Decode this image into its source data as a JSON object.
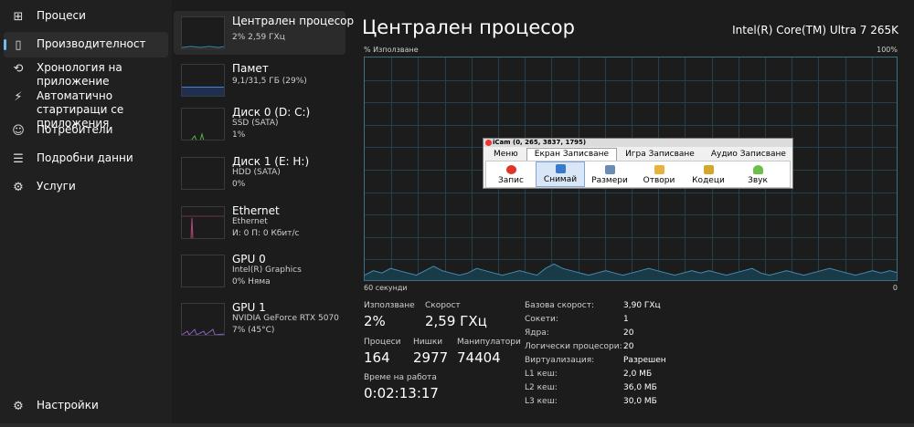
{
  "nav": {
    "items": [
      {
        "label": "Процеси",
        "icon": "processes-icon",
        "glyph": "⊞"
      },
      {
        "label": "Производителност",
        "icon": "performance-icon",
        "glyph": "▯",
        "active": true
      },
      {
        "label": "Хронология на приложение",
        "icon": "history-icon",
        "glyph": "⟲"
      },
      {
        "label": "Автоматично стартиращи се приложения",
        "icon": "startup-icon",
        "glyph": "⚡"
      },
      {
        "label": "Потребители",
        "icon": "users-icon",
        "glyph": "☺"
      },
      {
        "label": "Подробни данни",
        "icon": "details-icon",
        "glyph": "☰"
      },
      {
        "label": "Услуги",
        "icon": "services-icon",
        "glyph": "⚙"
      }
    ],
    "settings": {
      "label": "Настройки",
      "icon": "settings-icon",
      "glyph": "⚙"
    }
  },
  "devices": [
    {
      "title": "Централен процесор",
      "sub1": "2% 2,59 ГХц",
      "sub2": "",
      "color": "#3d8fb5"
    },
    {
      "title": "Памет",
      "sub1": "9,1/31,5 ГБ (29%)",
      "sub2": "",
      "color": "#4b7fd1"
    },
    {
      "title": "Диск 0 (D: C:)",
      "sub1": "SSD (SATA)",
      "sub2": "1%",
      "color": "#5cae4c"
    },
    {
      "title": "Диск 1 (E: H:)",
      "sub1": "HDD (SATA)",
      "sub2": "0%",
      "color": "#5cae4c"
    },
    {
      "title": "Ethernet",
      "sub1": "Ethernet",
      "sub2": "И: 0 П: 0 Кбит/с",
      "color": "#b5487a"
    },
    {
      "title": "GPU 0",
      "sub1": "Intel(R) Graphics",
      "sub2": "0% Няма",
      "color": "#8e5cc4"
    },
    {
      "title": "GPU 1",
      "sub1": "NVIDIA GeForce RTX 5070",
      "sub2": "7% (45°C)",
      "color": "#8e5cc4"
    }
  ],
  "main": {
    "title": "Централен процесор",
    "cpu_model": "Intel(R) Core(TM) Ultra 7 265K",
    "graph": {
      "y_label": "% Използване",
      "y_max_label": "100%",
      "x_left_label": "60 секунди",
      "x_right_label": "0",
      "line_color": "#3d8fb5",
      "fill_color": "#1b3a48",
      "values": [
        3,
        5,
        4,
        6,
        5,
        4,
        3,
        5,
        7,
        5,
        4,
        3,
        4,
        6,
        5,
        4,
        3,
        4,
        5,
        4,
        3,
        6,
        8,
        6,
        5,
        4,
        3,
        4,
        5,
        4,
        3,
        4,
        5,
        6,
        5,
        4,
        3,
        4,
        5,
        4,
        5,
        4,
        3,
        4,
        5,
        6,
        4,
        3,
        4,
        5,
        4,
        3,
        4,
        5,
        6,
        5,
        4,
        3,
        4,
        5,
        4,
        5,
        4
      ]
    },
    "stats": {
      "usage_label": "Използване",
      "usage": "2%",
      "speed_label": "Скорост",
      "speed": "2,59 ГХц",
      "processes_label": "Процеси",
      "processes": "164",
      "threads_label": "Нишки",
      "threads": "2977",
      "handles_label": "Манипулатори",
      "handles": "74404",
      "uptime_label": "Време на работа",
      "uptime": "0:02:13:17"
    },
    "specs": [
      {
        "k": "Базова скорост:",
        "v": "3,90 ГХц"
      },
      {
        "k": "Сокети:",
        "v": "1"
      },
      {
        "k": "Ядра:",
        "v": "20"
      },
      {
        "k": "Логически процесори:",
        "v": "20"
      },
      {
        "k": "Виртуализация:",
        "v": "Разрешен"
      },
      {
        "k": "L1 кеш:",
        "v": "2,0 МБ"
      },
      {
        "k": "L2 кеш:",
        "v": "36,0 МБ"
      },
      {
        "k": "L3 кеш:",
        "v": "30,0 МБ"
      }
    ]
  },
  "icam": {
    "title": "iCam (0, 265, 3837, 1795)",
    "tabs": [
      "Меню",
      "Екран Записване",
      "Игра Записване",
      "Аудио Записване"
    ],
    "active_tab": 1,
    "buttons": [
      {
        "label": "Запис",
        "icon": "record-icon",
        "color": "#e0342b"
      },
      {
        "label": "Снимай",
        "icon": "screenshot-icon",
        "color": "#3a78c9",
        "selected": true
      },
      {
        "label": "Размери",
        "icon": "dimensions-icon",
        "color": "#6a8db5"
      },
      {
        "label": "Отвори",
        "icon": "open-folder-icon",
        "color": "#e8b23c"
      },
      {
        "label": "Кодеци",
        "icon": "codecs-icon",
        "color": "#d4a72c"
      },
      {
        "label": "Звук",
        "icon": "sound-icon",
        "color": "#6cbf4a"
      }
    ]
  }
}
